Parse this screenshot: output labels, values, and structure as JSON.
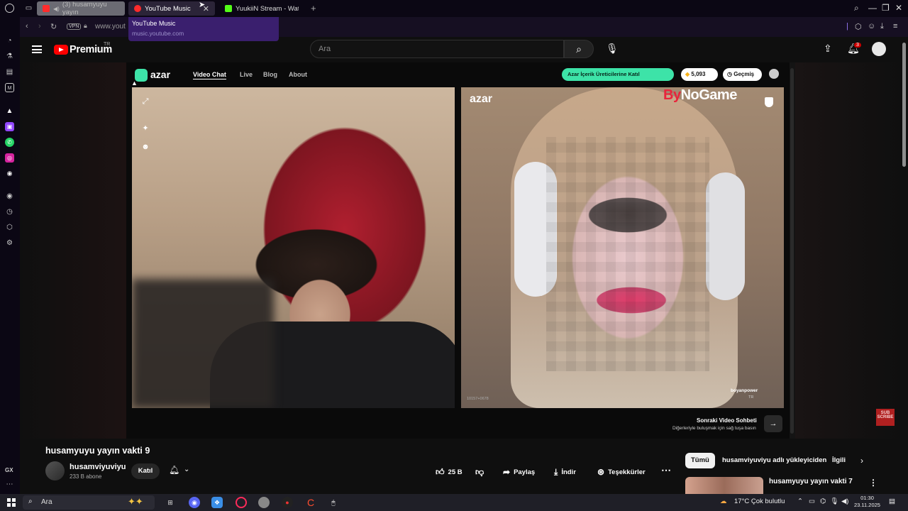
{
  "browser": {
    "tabs": [
      {
        "label": "(3) husamyuyu yayın"
      },
      {
        "label": "YouTube Music"
      },
      {
        "label": "YuukiiN Stream - Watch L"
      }
    ],
    "tooltip": {
      "title": "YouTube Music",
      "url": "music.youtube.com"
    },
    "address": {
      "vpn": "VPN",
      "url": "www.yout"
    },
    "sidebar_label": "GX"
  },
  "youtube": {
    "logo": "Premium",
    "region": "TR",
    "search_placeholder": "Ara",
    "notifications": "3"
  },
  "azar": {
    "brand": "azar",
    "nav": [
      "Video Chat",
      "Live",
      "Blog",
      "About"
    ],
    "creator_pill": "Azar İçerik Üreticilerine Katıl",
    "gems": "5,093",
    "history": "Geçmiş",
    "watermark": "azar",
    "sponsor_prefix": "By",
    "sponsor_suffix": "NoGame",
    "remote_user": "boyanpower",
    "remote_country": "TR",
    "cam_id": "10157+0678",
    "next_title": "Sonraki Video Sohbeti",
    "next_sub": "Diğerleriyle buluşmak için sağ tuşa basın"
  },
  "video": {
    "title": "husamyuyu yayın vakti 9",
    "channel": "husamviyuviyu",
    "subscribers": "233 B abone",
    "join": "Katıl",
    "likes": "25 B",
    "share": "Paylaş",
    "download": "İndir",
    "thanks": "Teşekkürler",
    "subscribe_badge": "SUB SCRIBE"
  },
  "recommendations": {
    "chips": [
      "Tümü",
      "husamviyuviyu adlı yükleyiciden",
      "İlgili"
    ],
    "first_title": "husamyuyu yayın vakti 7"
  },
  "taskbar": {
    "search": "Ara",
    "weather": "17°C  Çok bulutlu",
    "time": "01:30",
    "date": "23.11.2025"
  },
  "colors": {
    "youtube_red": "#ff0000",
    "azar_green": "#3de3a8",
    "opera_bg": "#0b0714",
    "tooltip_bg": "#3a1f6e"
  }
}
